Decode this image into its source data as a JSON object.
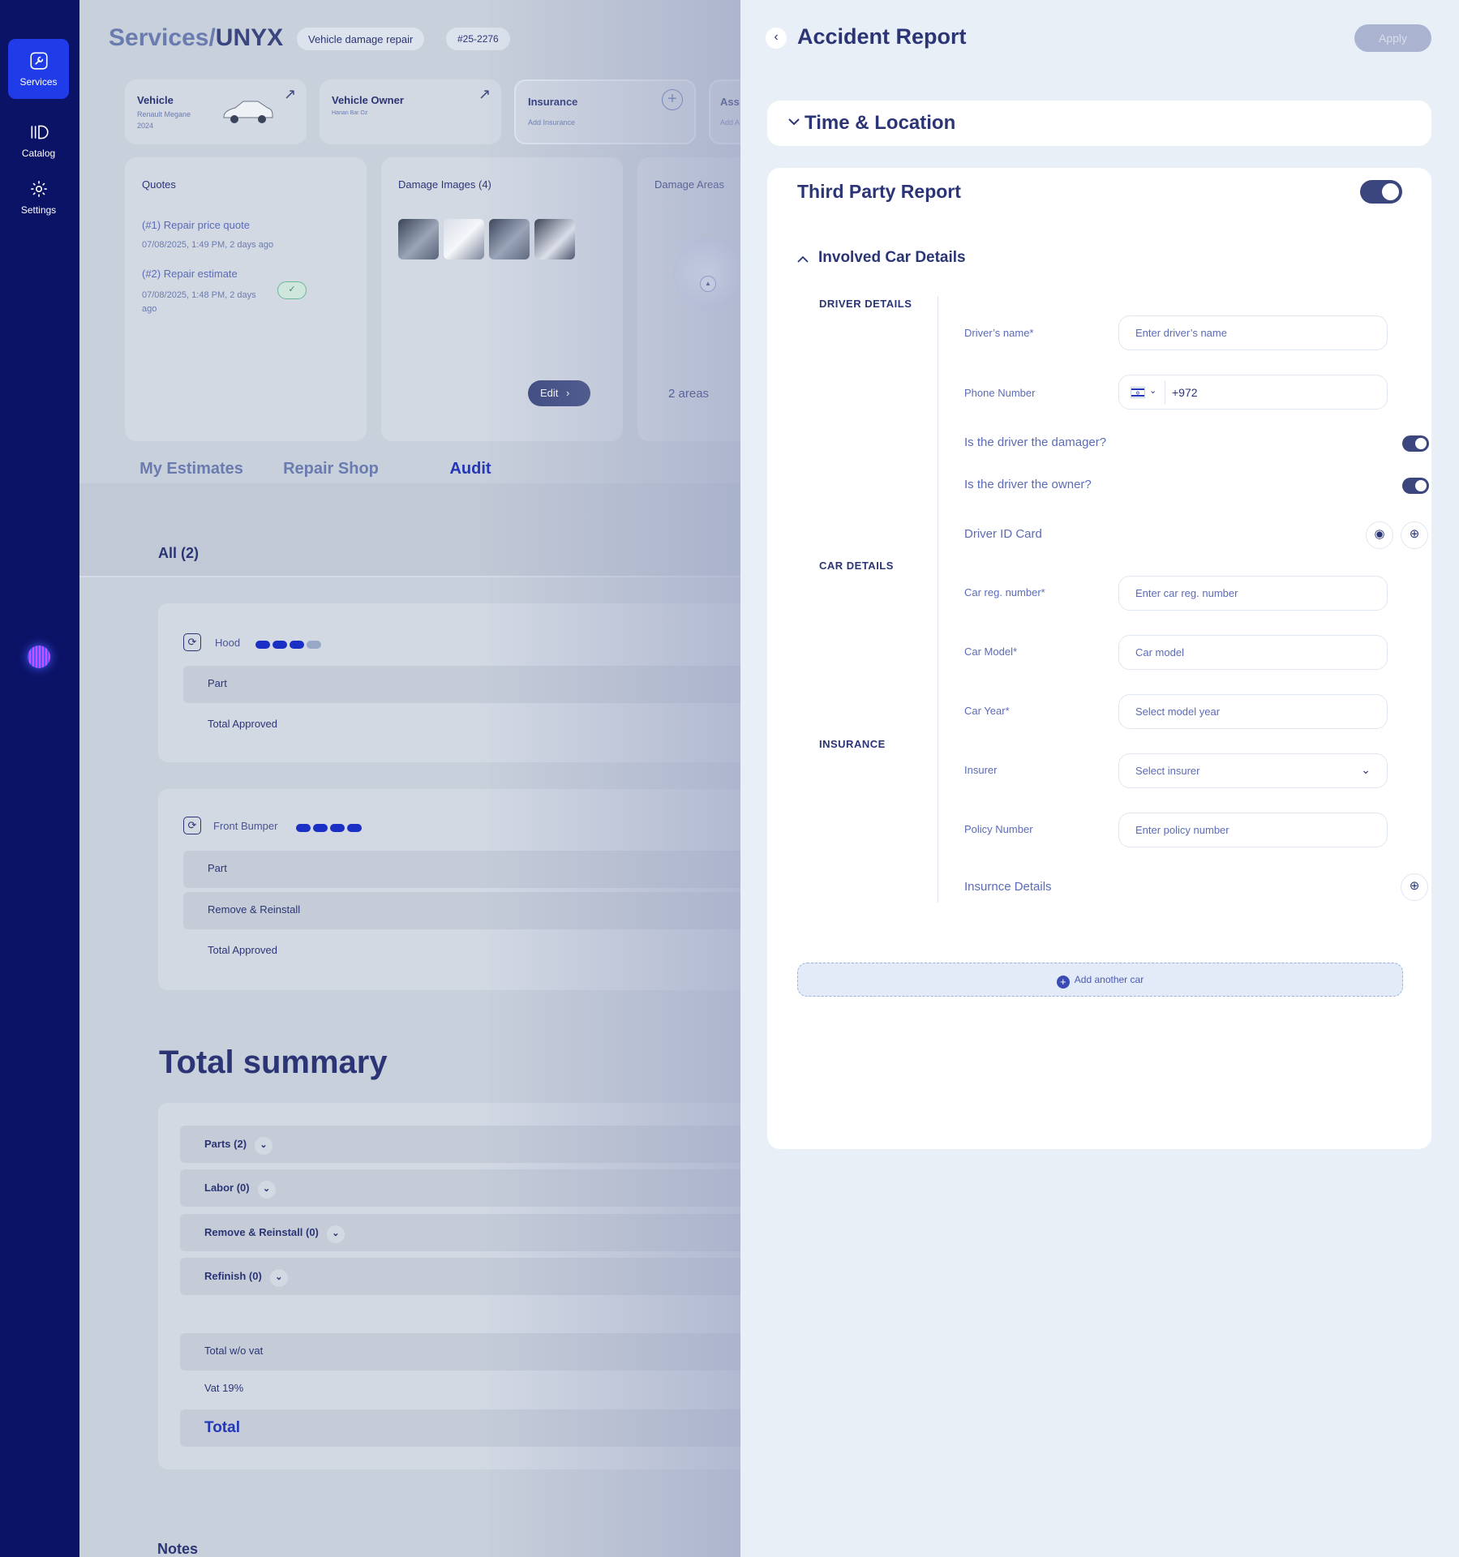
{
  "nav": {
    "items": [
      {
        "label": "Services",
        "icon": "wrench-icon"
      },
      {
        "label": "Catalog",
        "icon": "catalog-icon"
      },
      {
        "label": "Settings",
        "icon": "gear-icon"
      }
    ]
  },
  "background": {
    "title_prefix": "Services/",
    "title_main": "UNYX",
    "chip_service": "Vehicle damage repair",
    "chip_id": "#25-2276",
    "cards": {
      "vehicle_title": "Vehicle",
      "vehicle_sub1": "Renault Megane",
      "vehicle_sub2": "2024",
      "owner_title": "Vehicle Owner",
      "owner_sub": "Hanan Bar Oz",
      "insurance_title": "Insurance",
      "insurance_sub": "Add Insurance",
      "assess_title": "Ass",
      "assess_sub": "Add A"
    },
    "quotes": {
      "title": "Quotes",
      "q1_link": "(#1) Repair price quote",
      "q1_date": "07/08/2025, 1:49 PM, 2 days ago",
      "q2_link": "(#2) Repair estimate",
      "q2_date_a": "07/08/2025, 1:48 PM, 2 days",
      "q2_date_b": "ago"
    },
    "damage_images": {
      "title": "Damage Images (4)",
      "edit": "Edit"
    },
    "damage_areas": {
      "title": "Damage Areas",
      "count": "2 areas"
    },
    "tabs": [
      "My Estimates",
      "Repair Shop",
      "Audit"
    ],
    "all_count": "All (2)",
    "estimates": [
      {
        "name": "Hood",
        "rows": [
          "Part",
          "Total Approved"
        ]
      },
      {
        "name": "Front Bumper",
        "rows": [
          "Part",
          "Remove & Reinstall",
          "Total Approved"
        ]
      }
    ],
    "summary": {
      "title": "Total summary",
      "rows": [
        "Parts (2)",
        "Labor (0)",
        "Remove & Reinstall (0)",
        "Refinish (0)"
      ],
      "total_wo_vat": "Total w/o vat",
      "vat": "Vat 19%",
      "total": "Total"
    },
    "notes": "Notes"
  },
  "drawer": {
    "title": "Accident Report",
    "apply": "Apply",
    "time_location": "Time & Location",
    "third_party": "Third Party Report",
    "involved": "Involved Car Details",
    "groups": {
      "driver": "DRIVER DETAILS",
      "car": "CAR DETAILS",
      "insurance": "INSURANCE"
    },
    "fields": {
      "driver_name_label": "Driver’s name*",
      "driver_name_ph": "Enter driver’s name",
      "phone_label": "Phone Number",
      "phone_code": "+972",
      "damager_q": "Is the driver the damager?",
      "owner_q": "Is the driver the owner?",
      "id_card": "Driver ID Card",
      "reg_label": "Car reg. number*",
      "reg_ph": "Enter car reg. number",
      "model_label": "Car Model*",
      "model_ph": "Car model",
      "year_label": "Car Year*",
      "year_ph": "Select model year",
      "insurer_label": "Insurer",
      "insurer_ph": "Select insurer",
      "policy_label": "Policy Number",
      "policy_ph": "Enter policy number",
      "ins_details": "Insurnce Details"
    },
    "add_car": "Add another car"
  },
  "colors": {
    "nav_bg": "#0b1367",
    "nav_active": "#1f3ce8",
    "primary": "#2b3576",
    "accent": "#2236b8",
    "toggle_on": "#3a467d"
  }
}
